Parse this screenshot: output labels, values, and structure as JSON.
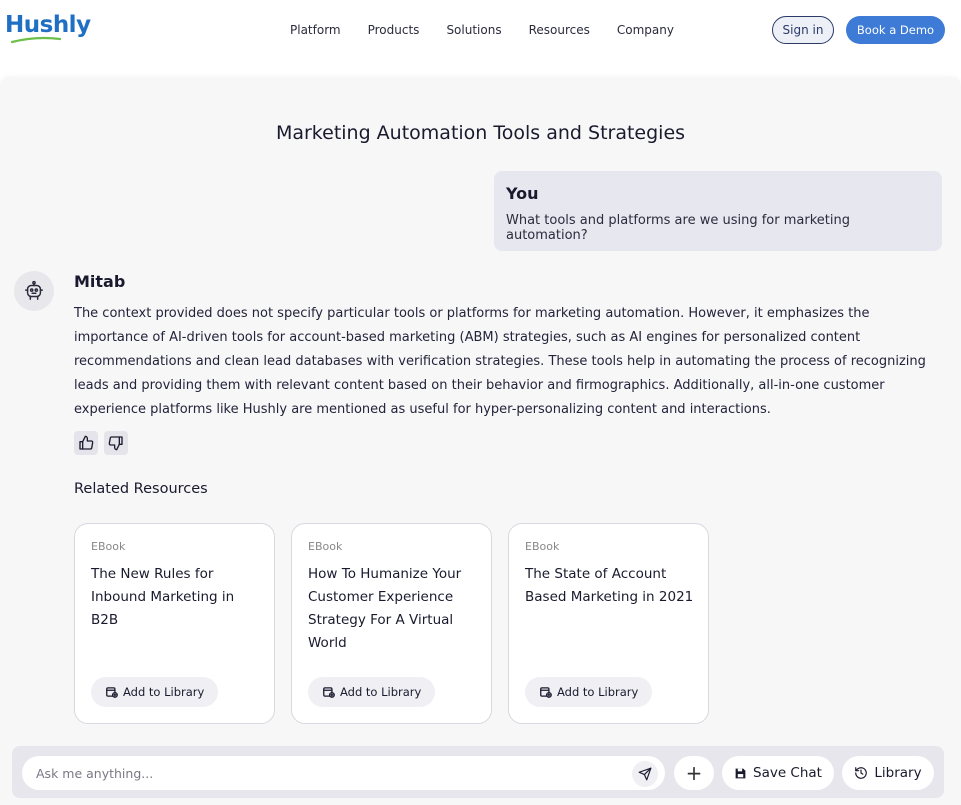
{
  "header": {
    "logo": "Hushly",
    "nav": [
      "Platform",
      "Products",
      "Solutions",
      "Resources",
      "Company"
    ],
    "signin_label": "Sign in",
    "demo_label": "Book a Demo"
  },
  "chat": {
    "title": "Marketing Automation Tools and Strategies",
    "user": {
      "name": "You",
      "message": "What tools and platforms are we using for marketing automation?"
    },
    "bot": {
      "name": "Mitab",
      "message": "The context provided does not specify particular tools or platforms for marketing automation. However, it emphasizes the importance of AI-driven tools for account-based marketing (ABM) strategies, such as AI engines for personalized content recommendations and clean lead databases with verification strategies. These tools help in automating the process of recognizing leads and providing them with relevant content based on their behavior and firmographics. Additionally, all-in-one customer experience platforms like Hushly are mentioned as useful for hyper-personalizing content and interactions."
    },
    "feedback": {
      "up_icon": "thumbs-up-icon",
      "down_icon": "thumbs-down-icon"
    }
  },
  "related": {
    "title": "Related Resources",
    "cards": [
      {
        "type": "EBook",
        "title": "The New Rules for Inbound Marketing in B2B",
        "action": "Add to Library"
      },
      {
        "type": "EBook",
        "title": "How To Humanize Your Customer Experience Strategy For A Virtual World",
        "action": "Add to Library"
      },
      {
        "type": "EBook",
        "title": "The State of Account Based Marketing in 2021",
        "action": "Add to Library"
      }
    ]
  },
  "composer": {
    "placeholder": "Ask me anything...",
    "plus_label": "+",
    "save_label": "Save Chat",
    "library_label": "Library"
  },
  "colors": {
    "brand_blue": "#3d7bd6",
    "logo_blue": "#1f6fc5",
    "logo_green": "#6cc04a",
    "panel_bg": "#f7f7f8"
  }
}
